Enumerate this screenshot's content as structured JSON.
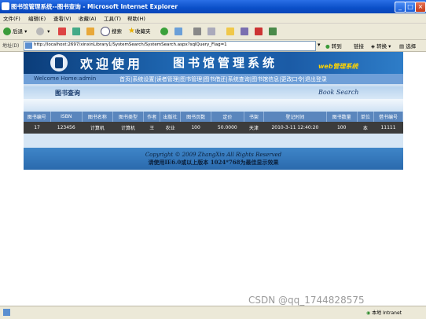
{
  "window": {
    "title": "图书馆管理系统--图书查询 - Microsoft Internet Explorer"
  },
  "menu": [
    "文件(F)",
    "编辑(E)",
    "查看(V)",
    "收藏(A)",
    "工具(T)",
    "帮助(H)"
  ],
  "toolbar": {
    "back": "后退",
    "search": "搜索",
    "favorites": "收藏夹"
  },
  "address": {
    "label": "地址(D)",
    "url": "http://localhost:2697/xinxinLibrary1/SystemSearch/SystemSearch.aspx?sqlQuery_Flag=1",
    "go": "转到",
    "links": "链接",
    "translate": "转换",
    "select": "选择"
  },
  "banner": {
    "welcome": "欢迎使用",
    "library": "图书馆管理系统",
    "web_admin": "web管理系统"
  },
  "nav": {
    "welcome": "Welcome Home:admin",
    "links": "首页|系统设置|读者管理|图书管理|图书借还|系统查询|图书馆信息|更改口令|退出登录"
  },
  "query_bar": {
    "left": "图书查询",
    "right": "Book Search"
  },
  "table": {
    "headers": [
      "图书编号",
      "ISBN",
      "图书名称",
      "图书类型",
      "作者",
      "出版社",
      "图书页数",
      "定价",
      "书架",
      "登记时间",
      "图书数量",
      "单位",
      "借书编号"
    ],
    "rows": [
      [
        "17",
        "123456",
        "计算机",
        "计算机",
        "王",
        "农业",
        "100",
        "50.0000",
        "天津",
        "2010-3-11 12:40:20",
        "100",
        "本",
        "11111"
      ]
    ]
  },
  "footer": {
    "copyright": "Copyright © 2009 ZhangXin   All Rights Reserved",
    "note": "请使用IE6.0或以上版本 1024*768为最佳显示效果"
  },
  "status": {
    "zone": "本地 Intranet"
  },
  "watermark": "CSDN @qq_1744828575"
}
